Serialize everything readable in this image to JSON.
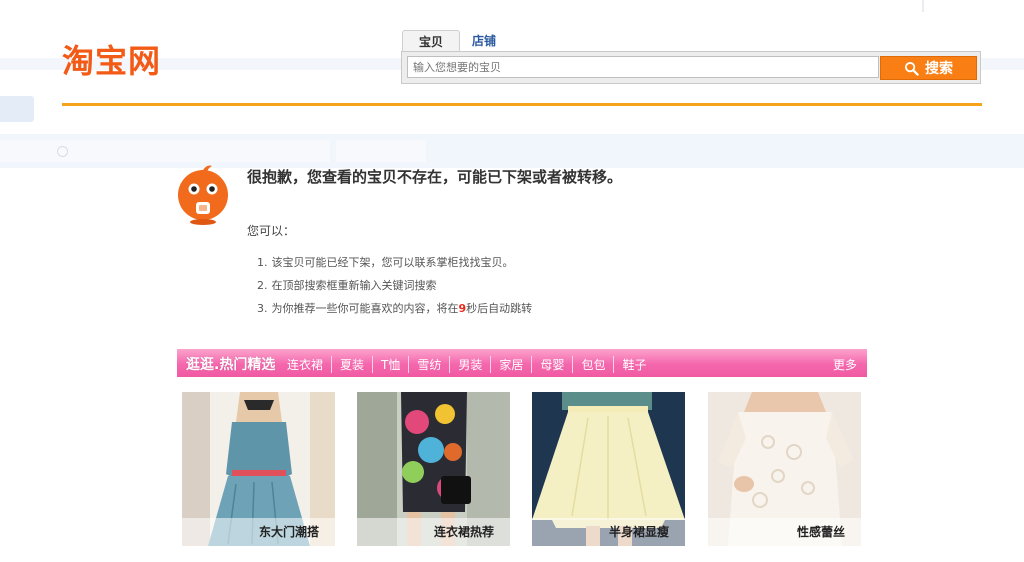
{
  "header": {
    "logo_text": "淘宝网",
    "brand_color": "#f25a15",
    "rule_color": "#f7a21b"
  },
  "search": {
    "tabs": [
      {
        "label": "宝贝",
        "active": true
      },
      {
        "label": "店铺",
        "active": false
      }
    ],
    "placeholder": "输入您想要的宝贝",
    "button_label": "搜索",
    "button_icon": "search-icon",
    "button_color": "#f97f14"
  },
  "error": {
    "mascot_icon": "taobao-mascot-icon",
    "title": "很抱歉，您查看的宝贝不存在，可能已下架或者被转移。",
    "you_can": "您可以：",
    "tips": [
      {
        "num": "1.",
        "text": "该宝贝可能已经下架，您可以联系掌柜找找宝贝。"
      },
      {
        "num": "2.",
        "text": "在顶部搜索框重新输入关键词搜索"
      },
      {
        "num": "3.",
        "text_before": "为你推荐一些你可能喜欢的内容，将在",
        "countdown": "9",
        "text_after": "秒后自动跳转"
      }
    ]
  },
  "hot_picks": {
    "title": "逛逛.热门精选",
    "categories": [
      "连衣裙",
      "夏装",
      "T恤",
      "雪纺",
      "男装",
      "家居",
      "母婴",
      "包包",
      "鞋子"
    ],
    "more_label": "更多",
    "bar_color": "#f467ad"
  },
  "products": [
    {
      "caption": "东大门潮搭"
    },
    {
      "caption": "连衣裙热荐"
    },
    {
      "caption": "半身裙显瘦"
    },
    {
      "caption": "性感蕾丝"
    }
  ]
}
